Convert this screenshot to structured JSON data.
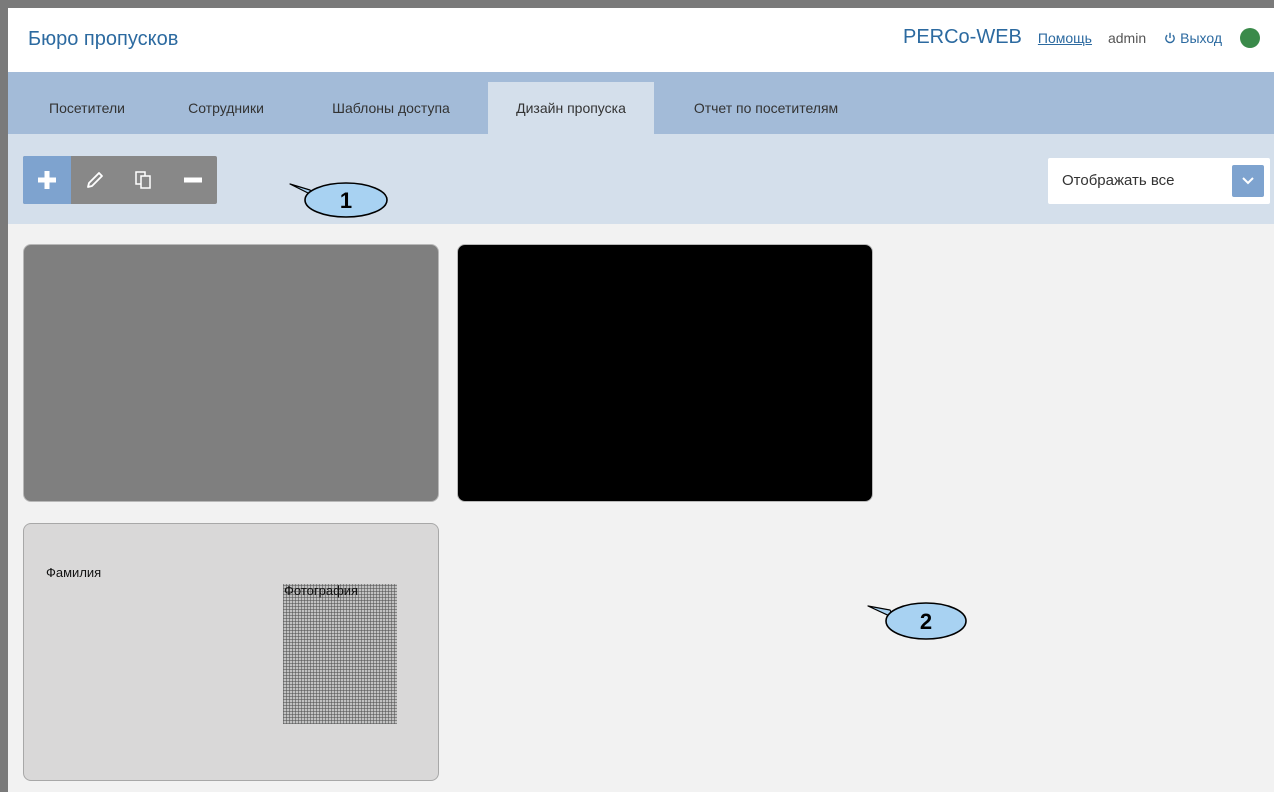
{
  "header": {
    "title": "Бюро пропусков",
    "brand": "PERCo-WEB",
    "help_label": "Помощь",
    "username": "admin",
    "logout_label": "Выход",
    "status_color": "#3a8a4a"
  },
  "tabs": [
    {
      "label": "Посетители",
      "active": false
    },
    {
      "label": "Сотрудники",
      "active": false
    },
    {
      "label": "Шаблоны доступа",
      "active": false
    },
    {
      "label": "Дизайн пропуска",
      "active": true
    },
    {
      "label": "Отчет по посетителям",
      "active": false
    }
  ],
  "toolbar": {
    "buttons": [
      "plus-icon",
      "pencil-icon",
      "copy-icon",
      "minus-icon"
    ],
    "filter_value": "Отображать все"
  },
  "cards": [
    {
      "background": "#7f7f7f",
      "fields": []
    },
    {
      "background": "#000000",
      "fields": []
    },
    {
      "background": "#d9d8d8",
      "fields": [
        "Фамилия",
        "Фотография"
      ]
    }
  ],
  "callouts": [
    "1",
    "2"
  ],
  "colors": {
    "accent": "#7ea3cf",
    "tab_bar": "#a3bbd8",
    "toolbar_bg": "#d4dfeb",
    "link": "#2c6aa0",
    "callout_fill": "#a8d2f2"
  }
}
